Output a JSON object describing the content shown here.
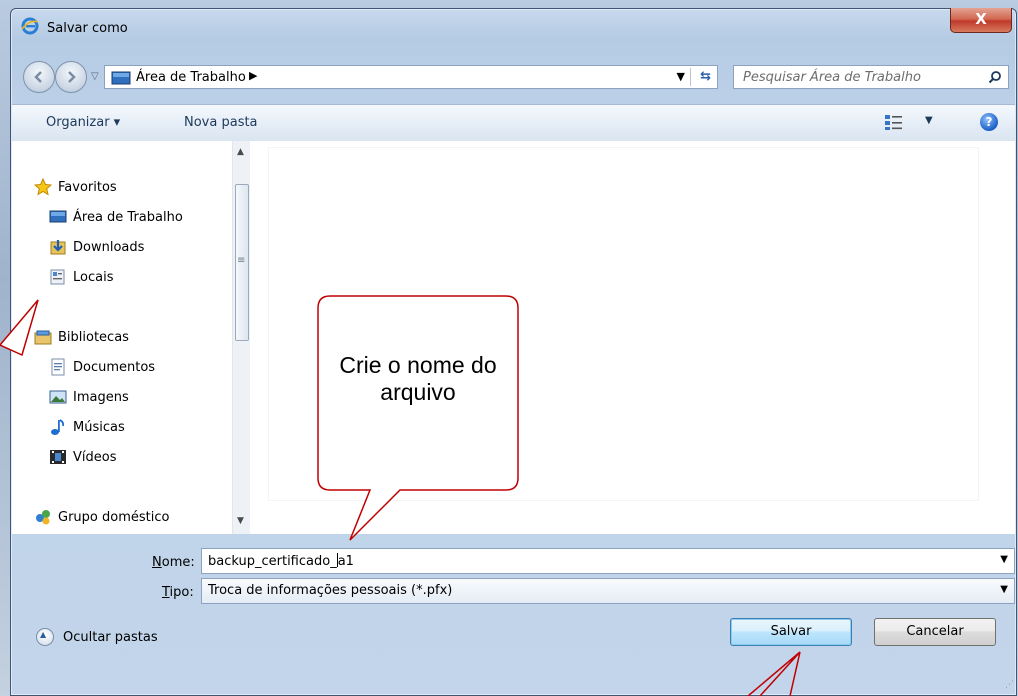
{
  "window": {
    "title": "Salvar como",
    "close_label": "X"
  },
  "address": {
    "location": "Área de Trabalho"
  },
  "search": {
    "placeholder": "Pesquisar Área de Trabalho"
  },
  "toolbar": {
    "organize_label": "Organizar ▾",
    "new_folder_label": "Nova pasta"
  },
  "nav": {
    "items": [
      {
        "label": "Favoritos",
        "icon": "star-icon"
      },
      {
        "label": "Área de Trabalho",
        "icon": "desktop-icon"
      },
      {
        "label": "Downloads",
        "icon": "downloads-icon"
      },
      {
        "label": "Locais",
        "icon": "places-icon"
      },
      {
        "label": "Bibliotecas",
        "icon": "library-icon"
      },
      {
        "label": "Documentos",
        "icon": "documents-icon"
      },
      {
        "label": "Imagens",
        "icon": "images-icon"
      },
      {
        "label": "Músicas",
        "icon": "music-icon"
      },
      {
        "label": "Vídeos",
        "icon": "videos-icon"
      },
      {
        "label": "Grupo doméstico",
        "icon": "homegroup-icon"
      }
    ]
  },
  "form": {
    "name_label_prefix": "N",
    "name_label_rest": "ome:",
    "name_value_before": "backup_certificado_",
    "name_value_after": "a1",
    "type_label_prefix": "T",
    "type_label_rest": "ipo:",
    "type_value": "Troca de informações pessoais (*.pfx)"
  },
  "buttons": {
    "save_label": "Salvar",
    "cancel_label": "Cancelar",
    "hide_folders_label": "Ocultar pastas"
  },
  "annotation": {
    "callout_text": "Crie o nome do arquivo"
  },
  "colors": {
    "dialog_frame": "#b5cbe4",
    "close_red": "#c0392b",
    "callout_red": "#c00000",
    "primary_button": "#bee6fd"
  }
}
